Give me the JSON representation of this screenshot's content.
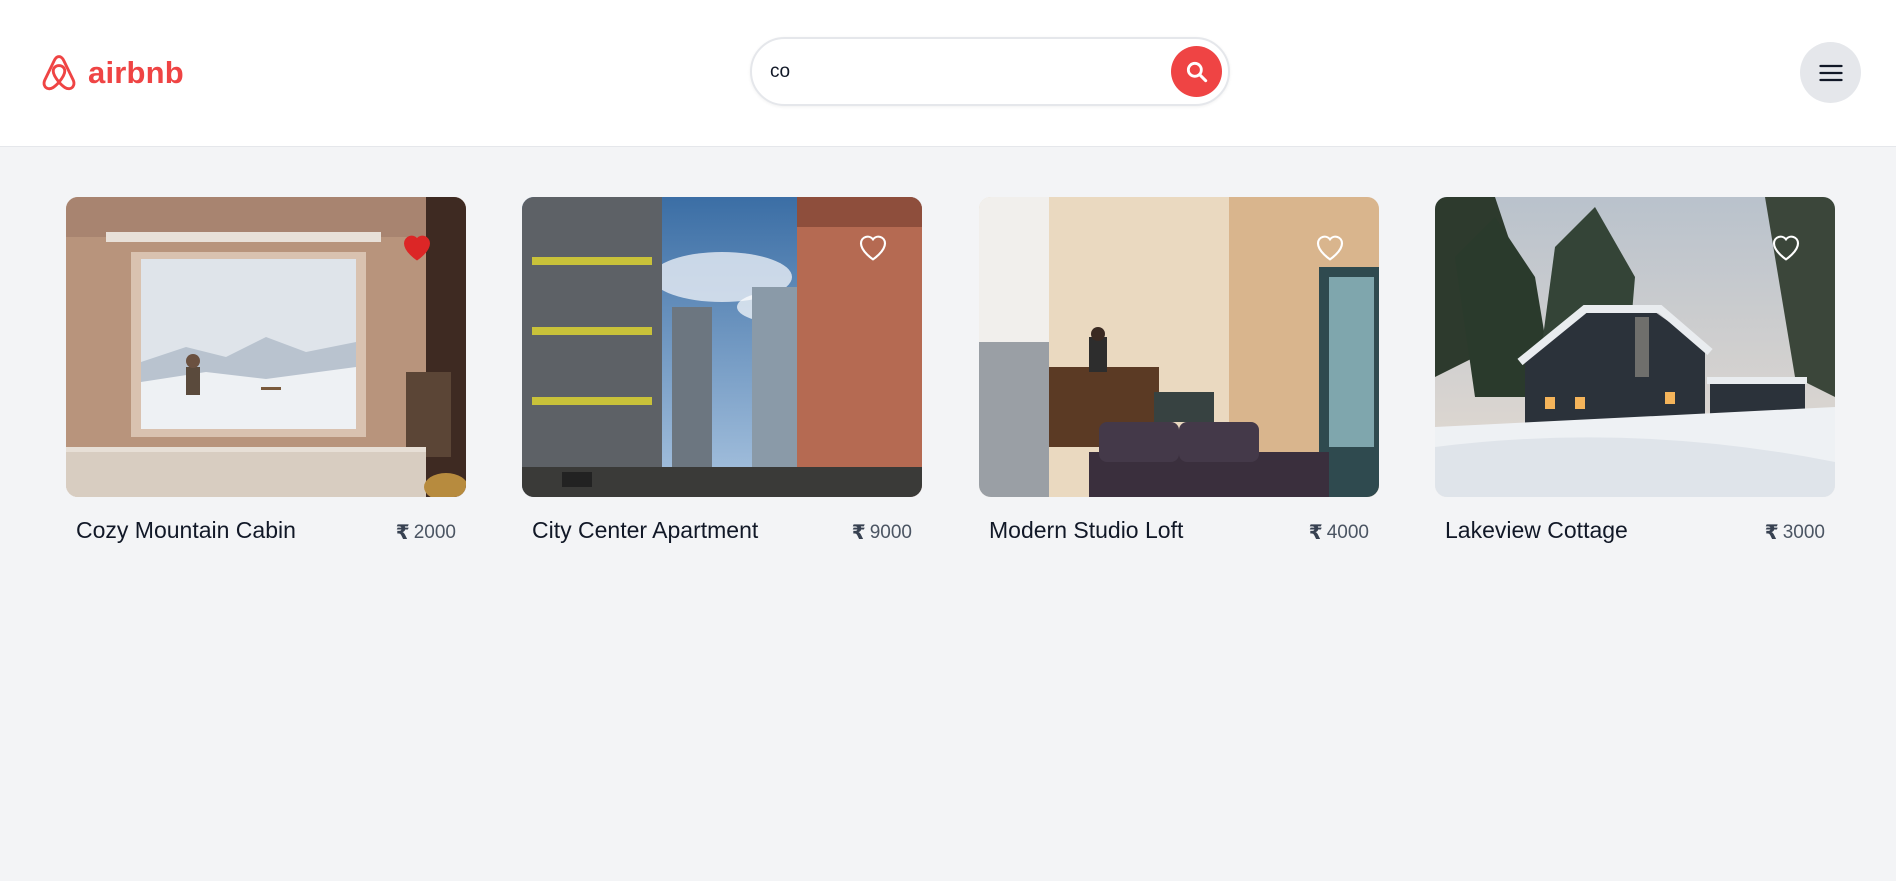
{
  "brand": {
    "name": "airbnb",
    "color": "#ef4444"
  },
  "search": {
    "value": "co",
    "placeholder": ""
  },
  "currency_symbol": "₹",
  "listings": [
    {
      "title": "Cozy Mountain Cabin",
      "price": "2000",
      "favorited": true
    },
    {
      "title": "City Center Apartment",
      "price": "9000",
      "favorited": false
    },
    {
      "title": "Modern Studio Loft",
      "price": "4000",
      "favorited": false
    },
    {
      "title": "Lakeview Cottage",
      "price": "3000",
      "favorited": false
    }
  ],
  "icons": {
    "logo": "airbnb-logo-icon",
    "search": "search-icon",
    "menu": "hamburger-menu-icon",
    "favorite": "heart-icon"
  },
  "colors": {
    "accent": "#ef4444",
    "page_background": "#f3f4f6",
    "header_background": "#ffffff",
    "heart_filled": "#dc2626"
  }
}
